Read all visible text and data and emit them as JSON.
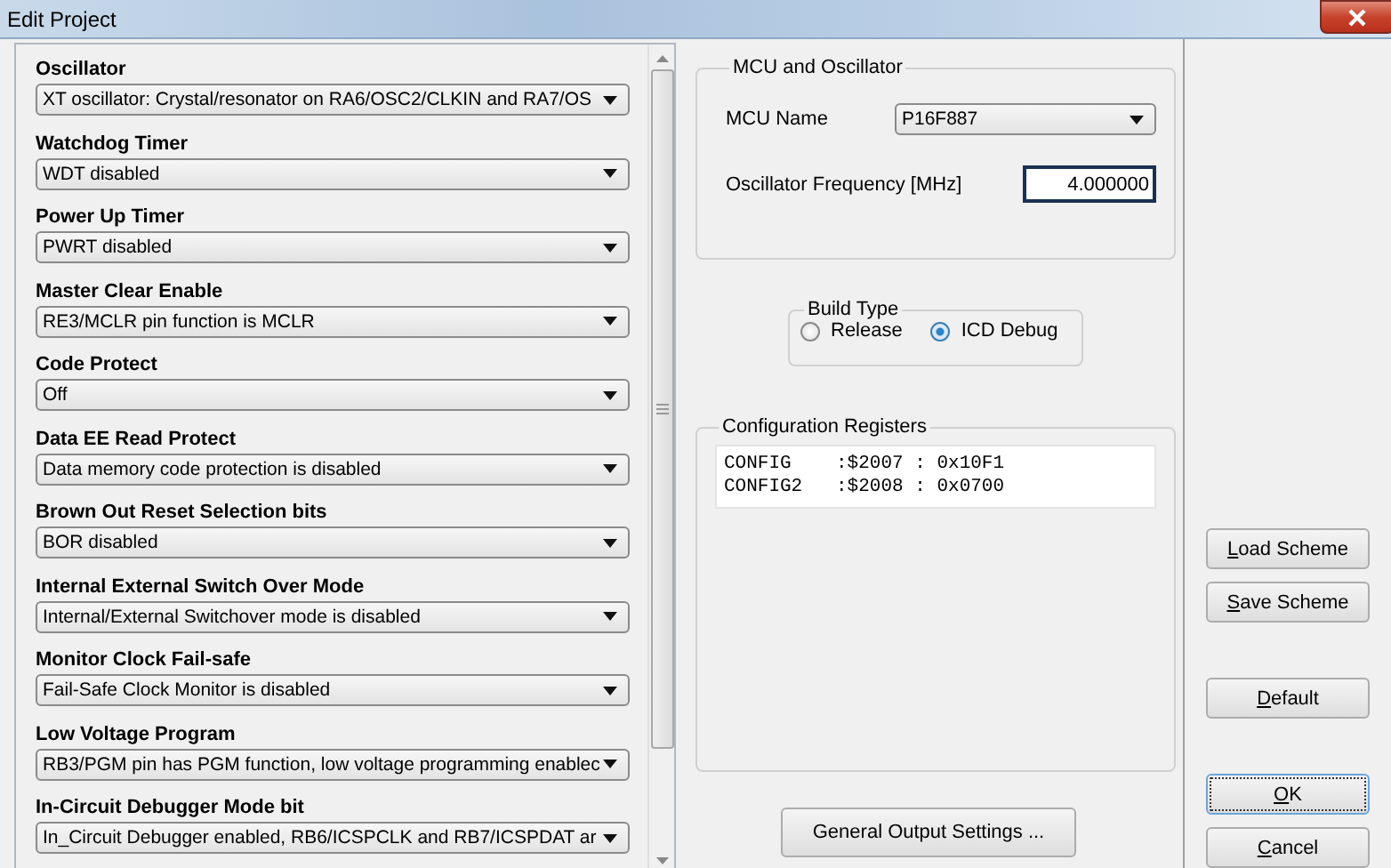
{
  "window": {
    "title": "Edit Project"
  },
  "settings": [
    {
      "label": "Oscillator",
      "value": "XT oscillator: Crystal/resonator on RA6/OSC2/CLKIN and RA7/OS"
    },
    {
      "label": "Watchdog Timer",
      "value": "WDT disabled"
    },
    {
      "label": "Power Up Timer",
      "value": "PWRT disabled"
    },
    {
      "label": "Master Clear Enable",
      "value": "RE3/MCLR pin function is MCLR"
    },
    {
      "label": "Code Protect",
      "value": "Off"
    },
    {
      "label": "Data EE Read Protect",
      "value": "Data memory code protection is disabled"
    },
    {
      "label": "Brown Out Reset Selection bits",
      "value": "BOR disabled"
    },
    {
      "label": "Internal External Switch Over Mode",
      "value": "Internal/External Switchover mode is disabled"
    },
    {
      "label": "Monitor Clock Fail-safe",
      "value": "Fail-Safe Clock Monitor is disabled"
    },
    {
      "label": "Low Voltage Program",
      "value": "RB3/PGM pin has PGM function, low voltage programming enablec"
    },
    {
      "label": "In-Circuit Debugger Mode bit",
      "value": "In_Circuit Debugger enabled, RB6/ICSPCLK and RB7/ICSPDAT ar"
    }
  ],
  "mcu_group": {
    "title": "MCU and Oscillator",
    "mcu_label": "MCU Name",
    "mcu_value": "P16F887",
    "freq_label": "Oscillator Frequency [MHz]",
    "freq_value": "4.000000"
  },
  "build_type": {
    "title": "Build Type",
    "options": [
      {
        "label": "Release",
        "selected": false
      },
      {
        "label": "ICD Debug",
        "selected": true
      }
    ]
  },
  "config_registers": {
    "title": "Configuration Registers",
    "lines": [
      {
        "name": "CONFIG",
        "address": ":$2007",
        "sep": ":",
        "value": "0x10F1"
      },
      {
        "name": "CONFIG2",
        "address": ":$2008",
        "sep": ":",
        "value": "0x0700"
      }
    ]
  },
  "general_button": "General Output Settings ...",
  "buttons": [
    {
      "label": "Load Scheme",
      "access_key_underlined": true,
      "focused": false
    },
    {
      "label": "Save Scheme",
      "access_key_underlined": true,
      "focused": false
    },
    {
      "label": "Default",
      "access_key_underlined": true,
      "focused": false
    },
    {
      "label": "OK",
      "access_key_underlined": true,
      "focused": true
    },
    {
      "label": "Cancel",
      "access_key_underlined": true,
      "focused": false
    }
  ]
}
